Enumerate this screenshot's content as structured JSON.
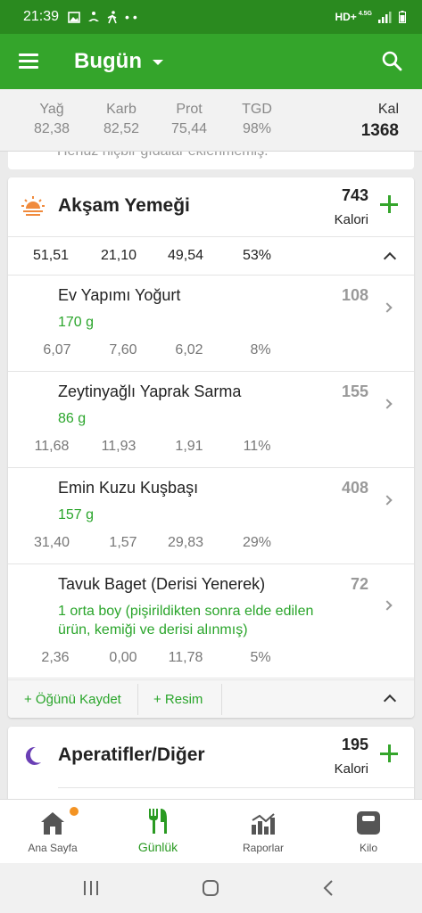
{
  "status_bar": {
    "time": "21:39",
    "network": "HD+",
    "network_sub": "4.5G",
    "icons": [
      "image-icon",
      "yoga-icon",
      "walking-icon",
      "more-icon",
      "signal-icon",
      "battery-icon"
    ]
  },
  "app_bar": {
    "title": "Bugün"
  },
  "summary": {
    "columns": [
      {
        "label": "Yağ",
        "value": "82,38"
      },
      {
        "label": "Karb",
        "value": "82,52"
      },
      {
        "label": "Prot",
        "value": "75,44"
      },
      {
        "label": "TGD",
        "value": "98%"
      }
    ],
    "kal_label": "Kal",
    "kal_value": "1368"
  },
  "previous_card": {
    "text": "Henüz hiçbir gıdalar eklenmemiş."
  },
  "meal": {
    "title": "Akşam Yemeği",
    "calories": "743",
    "calories_unit": "Kalori",
    "macros": [
      "51,51",
      "21,10",
      "49,54",
      "53%"
    ],
    "foods": [
      {
        "name": "Ev Yapımı Yoğurt",
        "kcal": "108",
        "qty": "170  g",
        "macros": [
          "6,07",
          "7,60",
          "6,02",
          "8%"
        ]
      },
      {
        "name": "Zeytinyağlı Yaprak Sarma",
        "kcal": "155",
        "qty": "86  g",
        "macros": [
          "11,68",
          "11,93",
          "1,91",
          "11%"
        ]
      },
      {
        "name": "Emin Kuzu Kuşbaşı",
        "kcal": "408",
        "qty": "157  g",
        "macros": [
          "31,40",
          "1,57",
          "29,83",
          "29%"
        ]
      },
      {
        "name": "Tavuk Baget (Derisi Yenerek)",
        "kcal": "72",
        "qty": "1  orta boy (pişirildikten sonra elde edilen ürün, kemiği ve derisi alınmış)",
        "macros": [
          "2,36",
          "0,00",
          "11,78",
          "5%"
        ]
      }
    ],
    "save_label": "+ Öğünü Kaydet",
    "photo_label": "+ Resim"
  },
  "meal2": {
    "title": "Aperatifler/Diğer",
    "calories": "195",
    "calories_unit": "Kalori"
  },
  "bottom_nav": [
    {
      "label": "Ana Sayfa",
      "icon": "home-icon"
    },
    {
      "label": "Günlük",
      "icon": "fork-knife-icon"
    },
    {
      "label": "Raporlar",
      "icon": "chart-icon"
    },
    {
      "label": "Kilo",
      "icon": "scale-icon"
    }
  ],
  "colors": {
    "brand": "#34a52b",
    "status_bar": "#2a8a1f",
    "accent_text": "#2aa52b",
    "notification_dot": "#f39323",
    "moon": "#6a3fb5"
  }
}
